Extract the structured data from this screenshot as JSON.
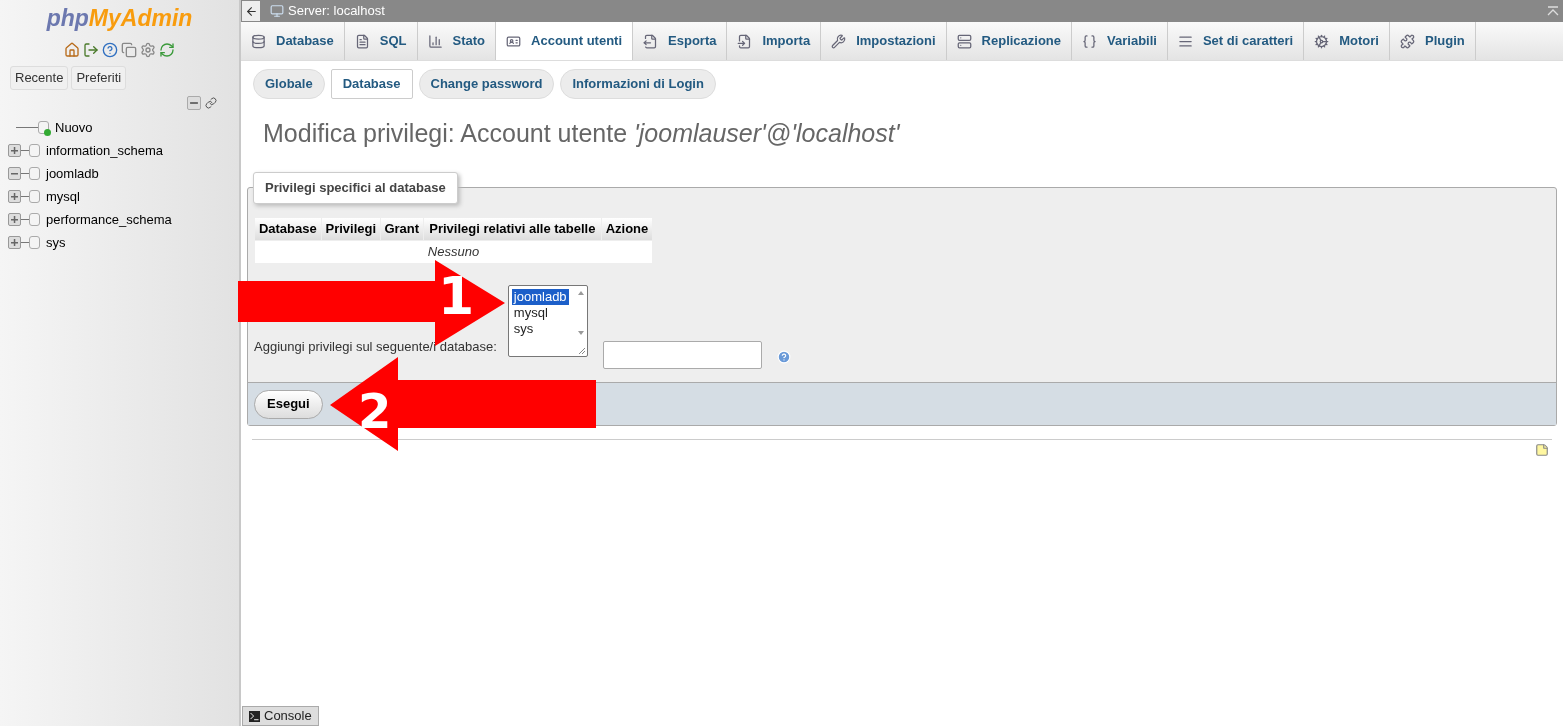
{
  "sidebar": {
    "logo": {
      "first": "php",
      "second": "MyAdmin"
    },
    "buttons": [
      {
        "label": "Recente"
      },
      {
        "label": "Preferiti"
      }
    ],
    "tree": [
      {
        "label": "Nuovo",
        "kind": "new"
      },
      {
        "label": "information_schema",
        "kind": "db",
        "expanded": false
      },
      {
        "label": "joomladb",
        "kind": "db",
        "expanded": true
      },
      {
        "label": "mysql",
        "kind": "db",
        "expanded": false
      },
      {
        "label": "performance_schema",
        "kind": "db",
        "expanded": false
      },
      {
        "label": "sys",
        "kind": "db",
        "expanded": false
      }
    ]
  },
  "topbar": {
    "title": "Server: localhost"
  },
  "tabs": [
    {
      "label": "Database",
      "selected": false
    },
    {
      "label": "SQL",
      "selected": false
    },
    {
      "label": "Stato",
      "selected": false
    },
    {
      "label": "Account utenti",
      "selected": true
    },
    {
      "label": "Esporta",
      "selected": false
    },
    {
      "label": "Importa",
      "selected": false
    },
    {
      "label": "Impostazioni",
      "selected": false
    },
    {
      "label": "Replicazione",
      "selected": false
    },
    {
      "label": "Variabili",
      "selected": false
    },
    {
      "label": "Set di caratteri",
      "selected": false
    },
    {
      "label": "Motori",
      "selected": false
    },
    {
      "label": "Plugin",
      "selected": false
    }
  ],
  "subtabs": [
    {
      "label": "Globale",
      "selected": false
    },
    {
      "label": "Database",
      "selected": true
    },
    {
      "label": "Change password",
      "selected": false
    },
    {
      "label": "Informazioni di Login",
      "selected": false
    }
  ],
  "heading": "Modifica privilegi: Account utente *'joomlauser'@'localhost'*",
  "fieldset": {
    "legend": "Privilegi specifici al database",
    "table": {
      "columns": [
        "Database",
        "Privilegi",
        "Grant",
        "Privilegi relativi alle tabelle",
        "Azione"
      ],
      "empty": "Nessuno"
    },
    "add_label": "Aggiungi privilegi sul seguente/i database:",
    "db_list": [
      {
        "label": "joomladb",
        "selected": true
      },
      {
        "label": "mysql",
        "selected": false
      },
      {
        "label": "sys",
        "selected": false
      }
    ],
    "submit": "Esegui"
  },
  "annotations": [
    {
      "label": "1",
      "kind": "arrow_right"
    },
    {
      "label": "2",
      "kind": "arrow_left"
    }
  ],
  "console": {
    "label": "Console"
  }
}
